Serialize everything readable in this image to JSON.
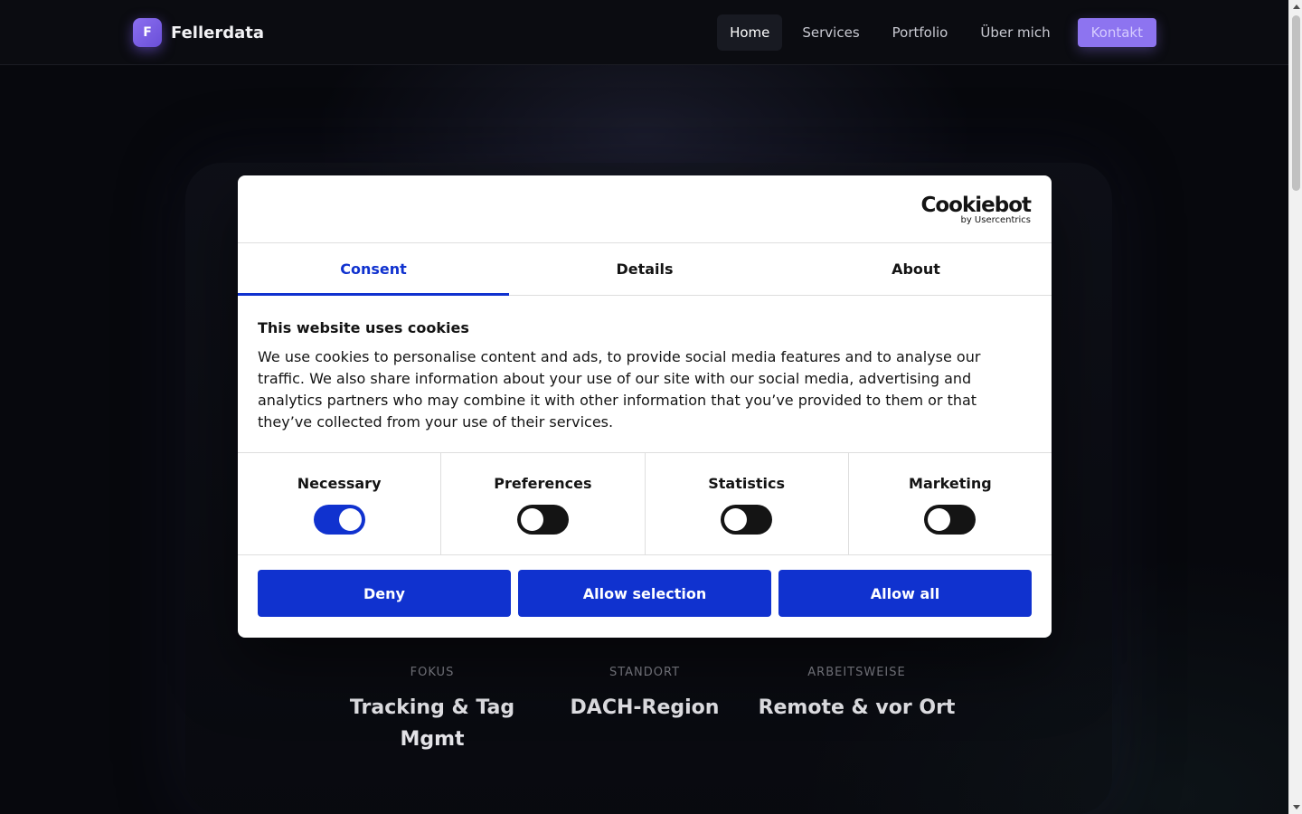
{
  "header": {
    "brand_initial": "F",
    "brand_name": "Fellerdata",
    "nav": [
      "Home",
      "Services",
      "Portfolio",
      "Über mich"
    ],
    "cta": "Kontakt"
  },
  "stats": [
    {
      "label": "FOKUS",
      "value": "Tracking & Tag Mgmt"
    },
    {
      "label": "STANDORT",
      "value": "DACH-Region"
    },
    {
      "label": "ARBEITSWEISE",
      "value": "Remote & vor Ort"
    }
  ],
  "cookie": {
    "logo_main": "Cookiebot",
    "logo_sub": "by Usercentrics",
    "tabs": [
      "Consent",
      "Details",
      "About"
    ],
    "title": "This website uses cookies",
    "text": "We use cookies to personalise content and ads, to provide social media features and to analyse our traffic. We also share information about your use of our site with our social media, advertising and analytics partners who may combine it with other information that you’ve provided to them or that they’ve collected from your use of their services.",
    "categories": [
      {
        "label": "Necessary",
        "enabled": true
      },
      {
        "label": "Preferences",
        "enabled": false
      },
      {
        "label": "Statistics",
        "enabled": false
      },
      {
        "label": "Marketing",
        "enabled": false
      }
    ],
    "buttons": {
      "deny": "Deny",
      "selection": "Allow selection",
      "all": "Allow all"
    }
  },
  "colors": {
    "accent": "#1032cf",
    "brand": "#8d74f0",
    "background": "#07080d"
  }
}
